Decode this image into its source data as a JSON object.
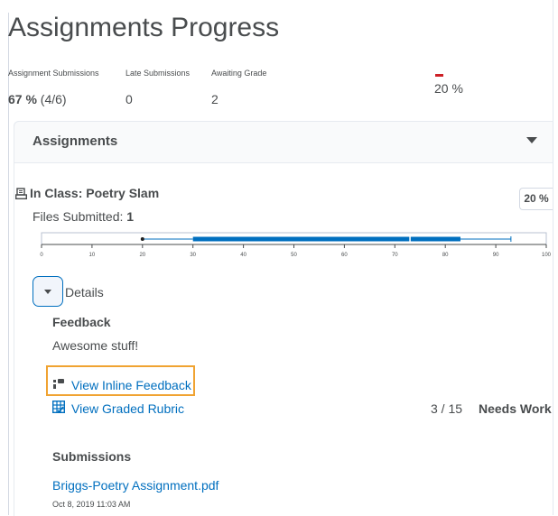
{
  "page": {
    "title": "Assignments Progress"
  },
  "stats": [
    {
      "label": "Assignment Submissions",
      "value_bold": "67 %",
      "value_rest": " (4/6)"
    },
    {
      "label": "Late Submissions",
      "value_bold": "",
      "value_rest": "0"
    },
    {
      "label": "Awaiting Grade",
      "value_bold": "",
      "value_rest": "2"
    }
  ],
  "overall_percent": "20 %",
  "colors": {
    "accent": "#006fbf",
    "highlight": "#f0a332",
    "alert": "#cd2026",
    "text": "#494c4e"
  },
  "panel": {
    "title": "Assignments",
    "toggle_icon": "caret-down-icon"
  },
  "assignment": {
    "icon": "dropbox-icon",
    "title": "In Class: Poetry Slam",
    "files_label": "Files Submitted: ",
    "files_count": "1",
    "grade_percent": "20 %"
  },
  "chart_data": {
    "type": "box",
    "x_ticks": [
      "0",
      "10",
      "20",
      "30",
      "40",
      "50",
      "60",
      "70",
      "80",
      "90",
      "100"
    ],
    "xlim": [
      0,
      100
    ],
    "min": 20,
    "q1": 30,
    "median": 73,
    "q3": 83,
    "max": 93,
    "marker": 20
  },
  "details": {
    "label": "Details",
    "feedback_heading": "Feedback",
    "feedback_text": "Awesome stuff!",
    "inline_feedback_link": "View Inline Feedback",
    "rubric_link": "View Graded Rubric",
    "rubric_score": "3 / 15",
    "rubric_level": "Needs Work"
  },
  "submissions": {
    "heading": "Submissions",
    "file_name": "Briggs-Poetry Assignment.pdf",
    "file_date": "Oct 8, 2019 11:03 AM"
  }
}
